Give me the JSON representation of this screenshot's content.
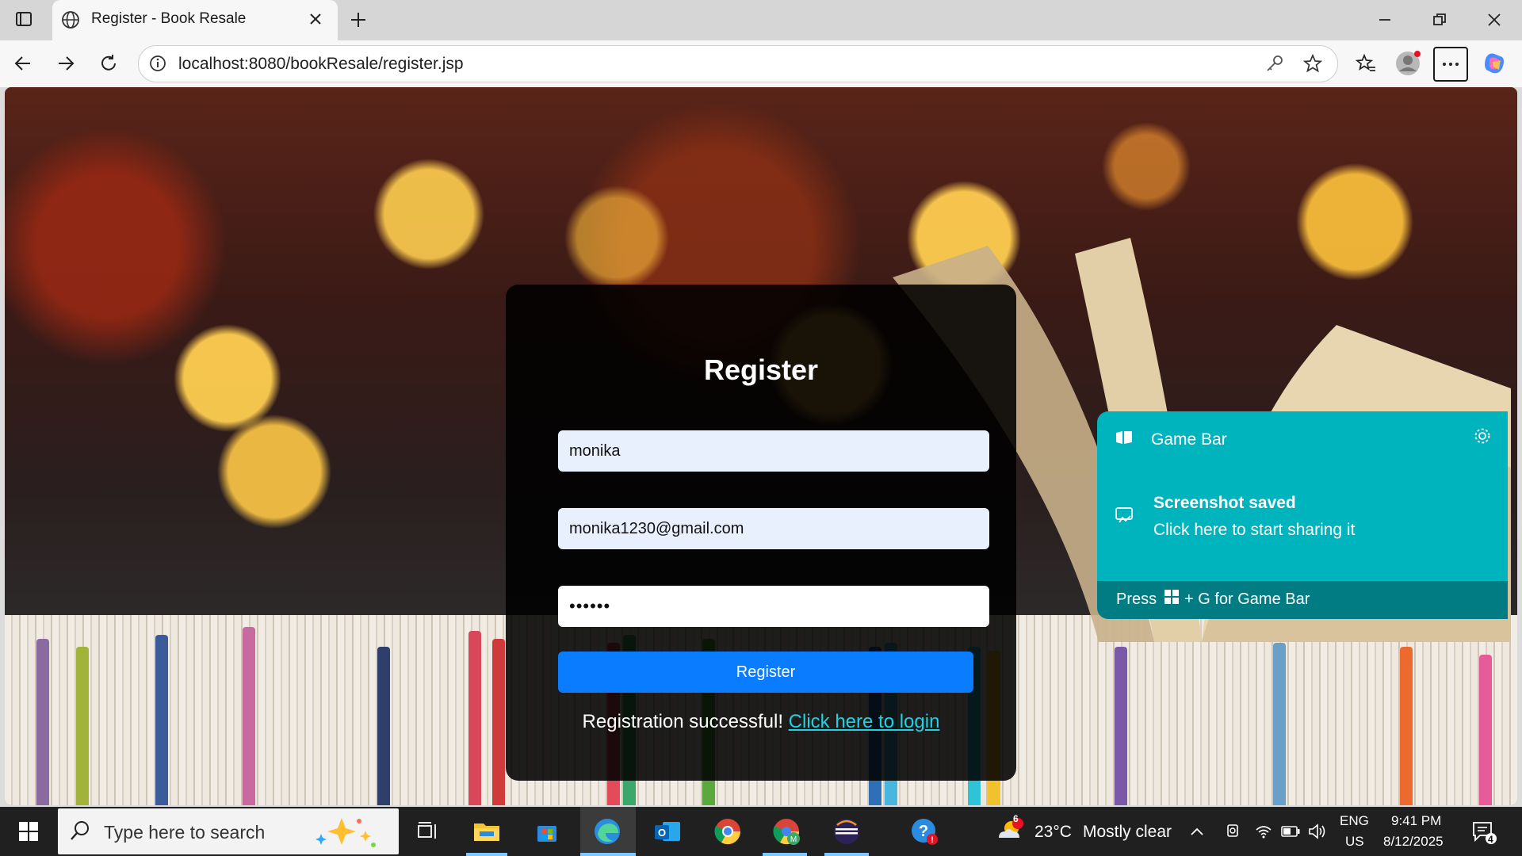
{
  "browser": {
    "tab_title": "Register - Book Resale",
    "url": "localhost:8080/bookResale/register.jsp"
  },
  "form": {
    "heading": "Register",
    "username_value": "monika",
    "email_value": "monika1230@gmail.com",
    "password_value": "••••••",
    "submit_label": "Register",
    "success_text": "Registration successful!",
    "login_link": "Click here to login"
  },
  "game_bar": {
    "title": "Game Bar",
    "notification_title": "Screenshot saved",
    "notification_body": "Click here to start sharing it",
    "footer_prefix": "Press",
    "footer_suffix": "+ G for Game Bar"
  },
  "taskbar": {
    "search_placeholder": "Type here to search",
    "weather_temp": "23°C",
    "weather_desc": "Mostly clear",
    "weather_badge": "6",
    "language": "ENG",
    "region": "US",
    "time": "9:41 PM",
    "date": "8/12/2025",
    "notification_count": "4"
  },
  "colors": {
    "accent": "#0a7cff",
    "link": "#1fd1e3",
    "game_bar": "#00b4bd"
  }
}
